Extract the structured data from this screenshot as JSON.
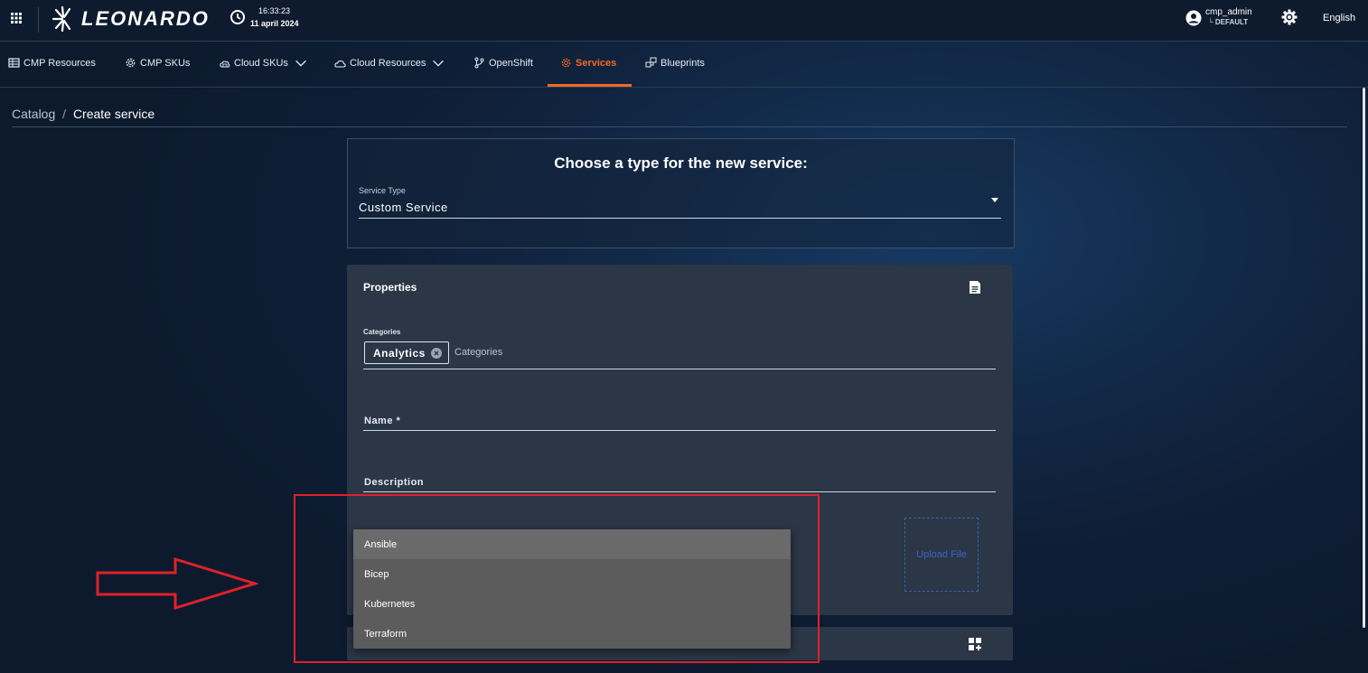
{
  "topbar": {
    "brand": "LEONARDO",
    "time": "16:33:23",
    "date": "11 april 2024",
    "user_name": "cmp_admin",
    "user_tenant": "└ DEFAULT",
    "language": "English",
    "accent_color": "#f26a21"
  },
  "nav": {
    "items": [
      {
        "label": "CMP Resources",
        "icon": "server-rack-icon"
      },
      {
        "label": "CMP SKUs",
        "icon": "gear-outline-icon"
      },
      {
        "label": "Cloud SKUs",
        "icon": "cloud-box-icon",
        "has_dropdown": true
      },
      {
        "label": "Cloud Resources",
        "icon": "cloud-icon",
        "has_dropdown": true
      },
      {
        "label": "OpenShift",
        "icon": "git-branch-icon"
      },
      {
        "label": "Services",
        "icon": "gear-outline-icon",
        "active": true
      },
      {
        "label": "Blueprints",
        "icon": "blueprint-icon"
      }
    ]
  },
  "breadcrumb": {
    "parent": "Catalog",
    "separator": "/",
    "current": "Create service"
  },
  "service_type_card": {
    "title": "Choose a type for the new service:",
    "field_label": "Service Type",
    "field_value": "Custom Service"
  },
  "properties_card": {
    "title": "Properties",
    "categories_label": "Categories",
    "chips": [
      "Analytics"
    ],
    "categories_placeholder": "Categories",
    "name_label": "Name *",
    "description_label": "Description",
    "upload_label": "Upload File"
  },
  "dropdown": {
    "options": [
      "Ansible",
      "Bicep",
      "Kubernetes",
      "Terraform"
    ],
    "highlighted": "Ansible"
  },
  "annotation": {
    "highlight_color": "#e0202a"
  }
}
